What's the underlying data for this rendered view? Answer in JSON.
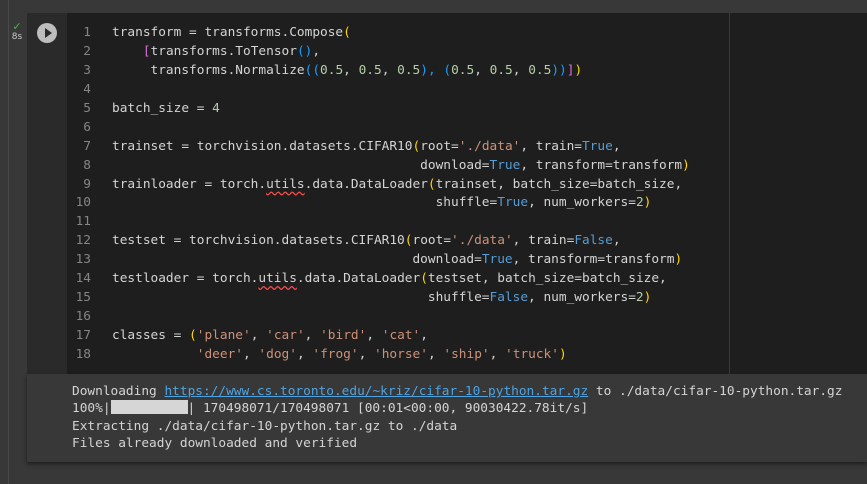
{
  "cell": {
    "exec_time": "8s",
    "code_lines": [
      [
        [
          "transform = transforms.Compose",
          "p"
        ],
        [
          "(",
          "y"
        ]
      ],
      [
        [
          "    ",
          "p"
        ],
        [
          "[",
          "m"
        ],
        [
          "transforms.ToTensor",
          "p"
        ],
        [
          "()",
          "b"
        ],
        [
          ",",
          "p"
        ]
      ],
      [
        [
          "     transforms.Normalize",
          "p"
        ],
        [
          "((",
          "b"
        ],
        [
          "0.5",
          "n"
        ],
        [
          ", ",
          "p"
        ],
        [
          "0.5",
          "n"
        ],
        [
          ", ",
          "p"
        ],
        [
          "0.5",
          "n"
        ],
        [
          "), (",
          "b"
        ],
        [
          "0.5",
          "n"
        ],
        [
          ", ",
          "p"
        ],
        [
          "0.5",
          "n"
        ],
        [
          ", ",
          "p"
        ],
        [
          "0.5",
          "n"
        ],
        [
          "))",
          "b"
        ],
        [
          "]",
          "m"
        ],
        [
          ")",
          "y"
        ]
      ],
      [],
      [
        [
          "batch_size = ",
          "p"
        ],
        [
          "4",
          "n"
        ]
      ],
      [],
      [
        [
          "trainset = torchvision.datasets.CIFAR10",
          "p"
        ],
        [
          "(",
          "y"
        ],
        [
          "root=",
          "p"
        ],
        [
          "'./data'",
          "s"
        ],
        [
          ", train=",
          "p"
        ],
        [
          "True",
          "k"
        ],
        [
          ",",
          "p"
        ]
      ],
      [
        [
          "                                        download=",
          "p"
        ],
        [
          "True",
          "k"
        ],
        [
          ", transform=transform",
          "p"
        ],
        [
          ")",
          "y"
        ]
      ],
      [
        [
          "trainloader = torch.",
          "p"
        ],
        [
          "utils",
          "pw"
        ],
        [
          ".data.DataLoader",
          "p"
        ],
        [
          "(",
          "y"
        ],
        [
          "trainset, batch_size=batch_size,",
          "p"
        ]
      ],
      [
        [
          "                                          shuffle=",
          "p"
        ],
        [
          "True",
          "k"
        ],
        [
          ", num_workers=",
          "p"
        ],
        [
          "2",
          "n"
        ],
        [
          ")",
          "y"
        ]
      ],
      [],
      [
        [
          "testset = torchvision.datasets.CIFAR10",
          "p"
        ],
        [
          "(",
          "y"
        ],
        [
          "root=",
          "p"
        ],
        [
          "'./data'",
          "s"
        ],
        [
          ", train=",
          "p"
        ],
        [
          "False",
          "k"
        ],
        [
          ",",
          "p"
        ]
      ],
      [
        [
          "                                       download=",
          "p"
        ],
        [
          "True",
          "k"
        ],
        [
          ", transform=transform",
          "p"
        ],
        [
          ")",
          "y"
        ]
      ],
      [
        [
          "testloader = torch.",
          "p"
        ],
        [
          "utils",
          "pw"
        ],
        [
          ".data.DataLoader",
          "p"
        ],
        [
          "(",
          "y"
        ],
        [
          "testset, batch_size=batch_size,",
          "p"
        ]
      ],
      [
        [
          "                                         shuffle=",
          "p"
        ],
        [
          "False",
          "k"
        ],
        [
          ", num_workers=",
          "p"
        ],
        [
          "2",
          "n"
        ],
        [
          ")",
          "y"
        ]
      ],
      [],
      [
        [
          "classes = ",
          "p"
        ],
        [
          "(",
          "y"
        ],
        [
          "'plane'",
          "s"
        ],
        [
          ", ",
          "p"
        ],
        [
          "'car'",
          "s"
        ],
        [
          ", ",
          "p"
        ],
        [
          "'bird'",
          "s"
        ],
        [
          ", ",
          "p"
        ],
        [
          "'cat'",
          "s"
        ],
        [
          ",",
          "p"
        ]
      ],
      [
        [
          "           ",
          "p"
        ],
        [
          "'deer'",
          "s"
        ],
        [
          ", ",
          "p"
        ],
        [
          "'dog'",
          "s"
        ],
        [
          ", ",
          "p"
        ],
        [
          "'frog'",
          "s"
        ],
        [
          ", ",
          "p"
        ],
        [
          "'horse'",
          "s"
        ],
        [
          ", ",
          "p"
        ],
        [
          "'ship'",
          "s"
        ],
        [
          ", ",
          "p"
        ],
        [
          "'truck'",
          "s"
        ],
        [
          ")",
          "y"
        ]
      ]
    ]
  },
  "output": {
    "line1_prefix": "Downloading ",
    "line1_link": "https://www.cs.toronto.edu/~kriz/cifar-10-python.tar.gz",
    "line1_suffix": " to ./data/cifar-10-python.tar.gz",
    "progress_percent_label": "100%|",
    "progress_fraction": 1.0,
    "progress_suffix": "| 170498071/170498071 [00:01<00:00, 90030422.78it/s]",
    "line3": "Extracting ./data/cifar-10-python.tar.gz to ./data",
    "line4": "Files already downloaded and verified"
  }
}
